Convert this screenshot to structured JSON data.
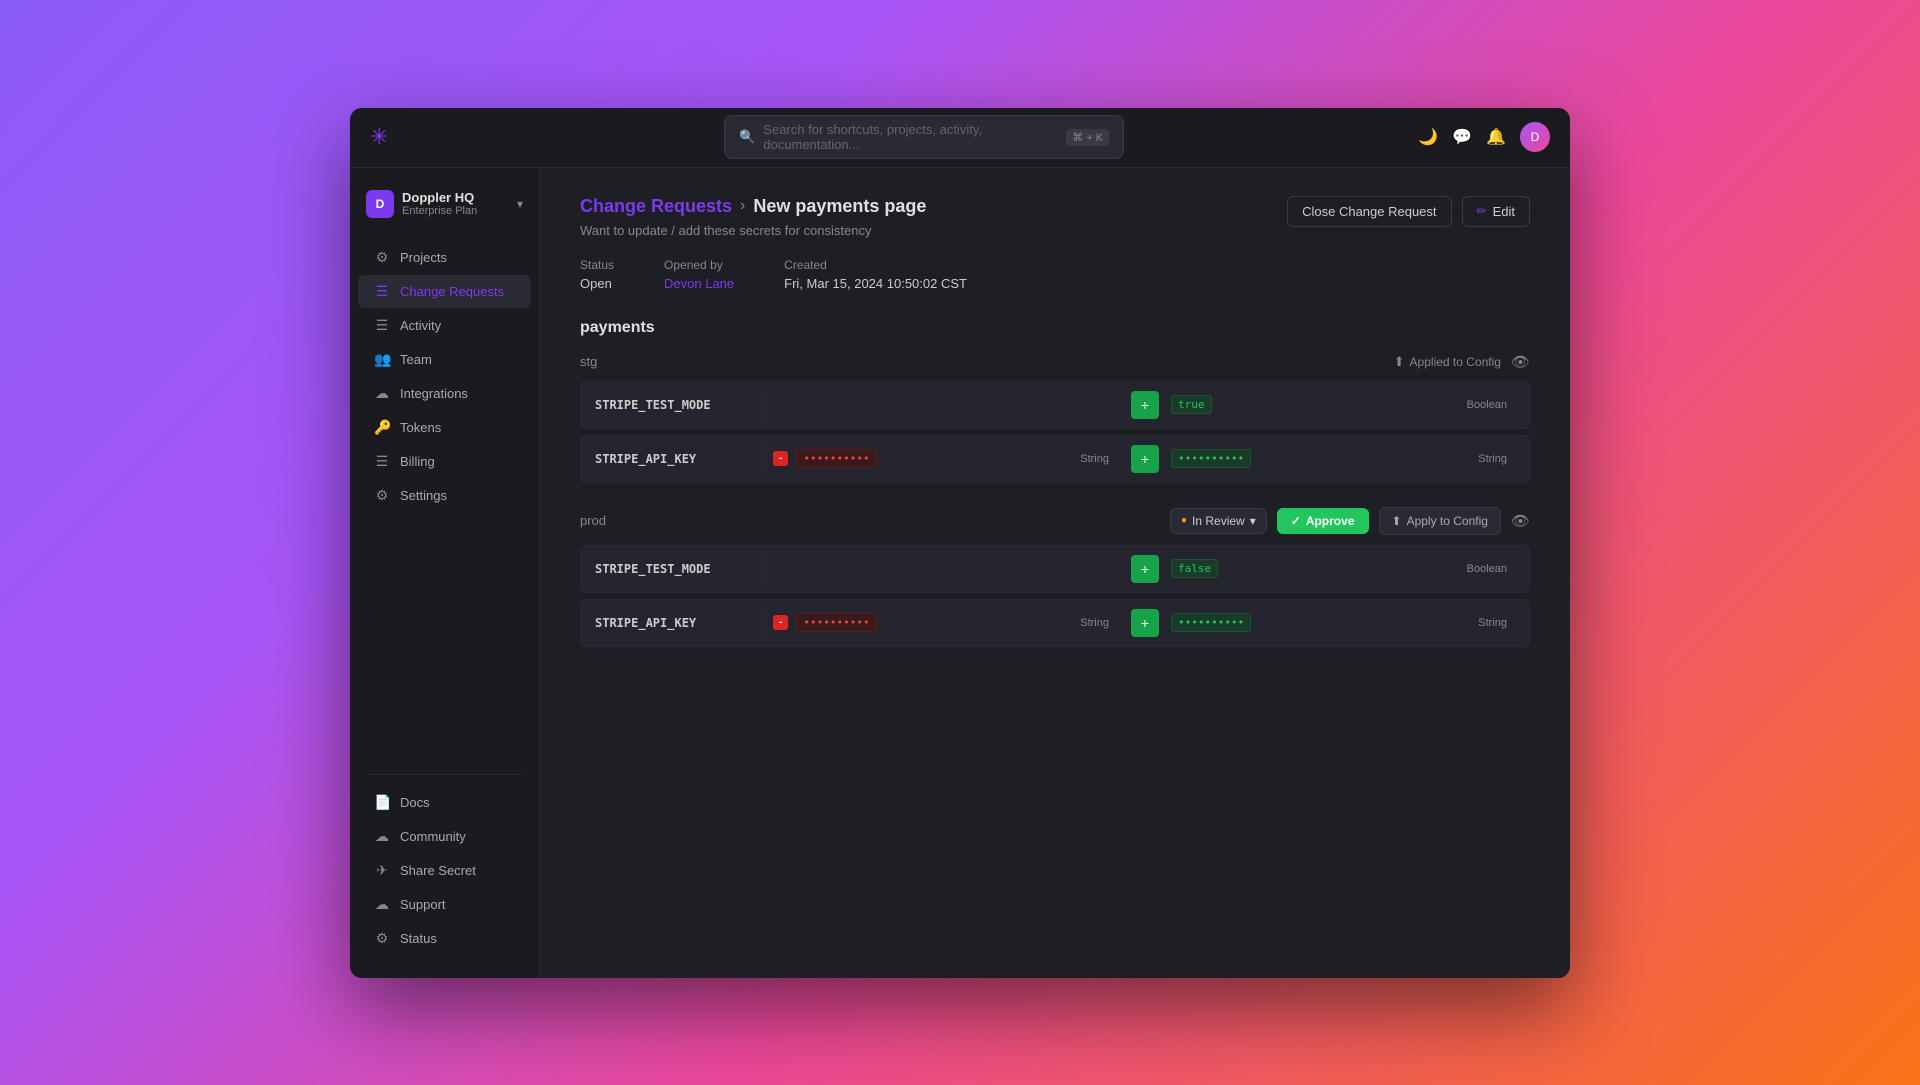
{
  "app": {
    "title": "Doppler HQ"
  },
  "topbar": {
    "search_placeholder": "Search for shortcuts, projects, activity, documentation...",
    "shortcut": "⌘ + K"
  },
  "sidebar": {
    "workspace": {
      "name": "Doppler HQ",
      "plan": "Enterprise Plan"
    },
    "nav_items": [
      {
        "id": "projects",
        "label": "Projects",
        "icon": "⚙"
      },
      {
        "id": "change-requests",
        "label": "Change Requests",
        "icon": "≡",
        "active": true
      },
      {
        "id": "activity",
        "label": "Activity",
        "icon": "≡"
      },
      {
        "id": "team",
        "label": "Team",
        "icon": "👥"
      },
      {
        "id": "integrations",
        "label": "Integrations",
        "icon": "☁"
      },
      {
        "id": "tokens",
        "label": "Tokens",
        "icon": "🔑"
      },
      {
        "id": "billing",
        "label": "Billing",
        "icon": "≡"
      },
      {
        "id": "settings",
        "label": "Settings",
        "icon": "⚙"
      }
    ],
    "bottom_items": [
      {
        "id": "docs",
        "label": "Docs",
        "icon": "📄"
      },
      {
        "id": "community",
        "label": "Community",
        "icon": "☁"
      },
      {
        "id": "share-secret",
        "label": "Share Secret",
        "icon": "✈"
      },
      {
        "id": "support",
        "label": "Support",
        "icon": "☁"
      },
      {
        "id": "status",
        "label": "Status",
        "icon": "⚙"
      }
    ]
  },
  "main": {
    "breadcrumb_link": "Change Requests",
    "breadcrumb_sep": "›",
    "title": "New payments page",
    "description": "Want to update / add these secrets for consistency",
    "actions": {
      "close_request": "Close Change Request",
      "edit": "Edit"
    },
    "meta": {
      "status_label": "Status",
      "status_value": "Open",
      "opened_by_label": "Opened by",
      "opened_by_value": "Devon Lane",
      "created_label": "Created",
      "created_value": "Fri, Mar 15, 2024 10:50:02 CST"
    },
    "section_title": "payments",
    "environments": [
      {
        "id": "stg",
        "name": "stg",
        "applied_config": "Applied to Config",
        "rows": [
          {
            "key": "STRIPE_TEST_MODE",
            "old_value": null,
            "old_type": null,
            "new_value": "true",
            "new_value_badge": "true",
            "type": "Boolean",
            "has_delete": false
          },
          {
            "key": "STRIPE_API_KEY",
            "old_value": "••••••••••",
            "old_type": "String",
            "new_value": "••••••••••",
            "type": "String",
            "has_delete": true
          }
        ]
      },
      {
        "id": "prod",
        "name": "prod",
        "in_review": "In Review",
        "approve": "Approve",
        "apply_config": "Apply to Config",
        "rows": [
          {
            "key": "STRIPE_TEST_MODE",
            "old_value": null,
            "old_type": null,
            "new_value": "false",
            "new_value_badge": "false",
            "type": "Boolean",
            "has_delete": false
          },
          {
            "key": "STRIPE_API_KEY",
            "old_value": "••••••••••",
            "old_type": "String",
            "new_value": "••••••••••",
            "type": "String",
            "has_delete": true
          }
        ]
      }
    ]
  }
}
